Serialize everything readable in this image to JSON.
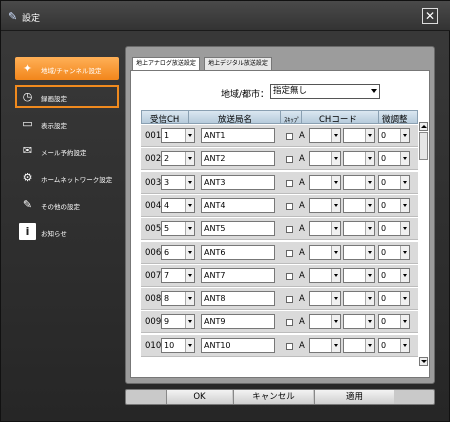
{
  "window": {
    "title": "設定",
    "close_label": "✕"
  },
  "sidebar": {
    "items": [
      {
        "label": "地域/チャンネル設定",
        "icon": "antenna-icon",
        "glyph": "✦",
        "state": "active"
      },
      {
        "label": "録画設定",
        "icon": "clock-icon",
        "glyph": "◷",
        "state": "highlight"
      },
      {
        "label": "表示設定",
        "icon": "display-icon",
        "glyph": "▭",
        "state": ""
      },
      {
        "label": "メール予約設定",
        "icon": "mail-icon",
        "glyph": "✉",
        "state": ""
      },
      {
        "label": "ホームネットワーク設定",
        "icon": "network-icon",
        "glyph": "⚙",
        "state": ""
      },
      {
        "label": "その他の設定",
        "icon": "wrench-icon",
        "glyph": "✎",
        "state": ""
      },
      {
        "label": "お知らせ",
        "icon": "info-icon",
        "glyph": "i",
        "state": ""
      }
    ]
  },
  "tabs": [
    {
      "label": "地上アナログ放送設定",
      "active": true
    },
    {
      "label": "地上デジタル放送設定",
      "active": false
    }
  ],
  "region": {
    "label": "地域/都市：",
    "value": "指定無し"
  },
  "table": {
    "headers": {
      "channel": "受信CH",
      "station": "放送局名",
      "skip": "ｽｷｯﾌﾟ",
      "code": "CHコード",
      "fine": "微調整"
    },
    "rows": [
      {
        "num": "001",
        "ch": "1",
        "name": "ANT1",
        "a": "A",
        "fine": "0"
      },
      {
        "num": "002",
        "ch": "2",
        "name": "ANT2",
        "a": "A",
        "fine": "0"
      },
      {
        "num": "003",
        "ch": "3",
        "name": "ANT3",
        "a": "A",
        "fine": "0"
      },
      {
        "num": "004",
        "ch": "4",
        "name": "ANT4",
        "a": "A",
        "fine": "0"
      },
      {
        "num": "005",
        "ch": "5",
        "name": "ANT5",
        "a": "A",
        "fine": "0"
      },
      {
        "num": "006",
        "ch": "6",
        "name": "ANT6",
        "a": "A",
        "fine": "0"
      },
      {
        "num": "007",
        "ch": "7",
        "name": "ANT7",
        "a": "A",
        "fine": "0"
      },
      {
        "num": "008",
        "ch": "8",
        "name": "ANT8",
        "a": "A",
        "fine": "0"
      },
      {
        "num": "009",
        "ch": "9",
        "name": "ANT9",
        "a": "A",
        "fine": "0"
      },
      {
        "num": "010",
        "ch": "10",
        "name": "ANT10",
        "a": "A",
        "fine": "0"
      }
    ]
  },
  "footer": {
    "ok": "OK",
    "cancel": "キャンセル",
    "apply": "適用"
  },
  "colors": {
    "accent": "#f2861b",
    "header_blue": "#c6d7e5",
    "row_bg": "#dadada"
  }
}
